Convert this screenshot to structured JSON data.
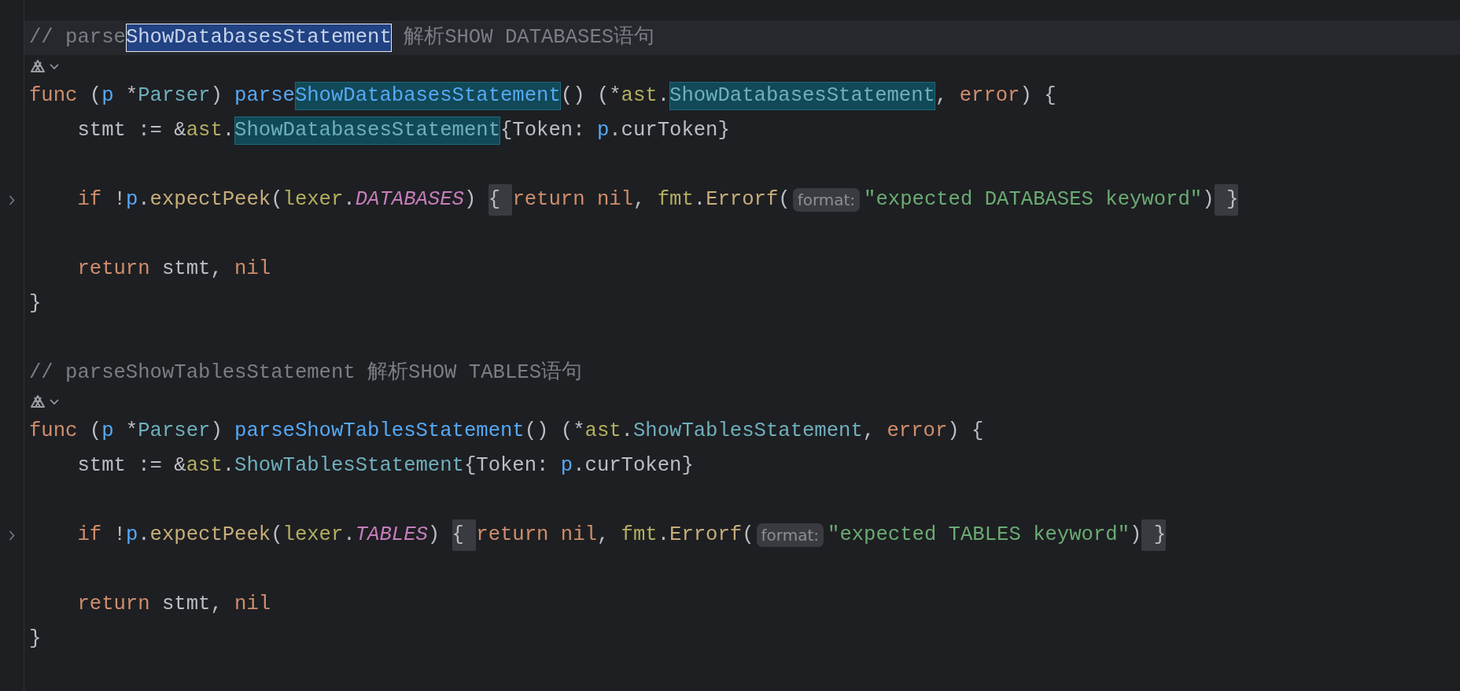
{
  "editor": {
    "lines": [
      {
        "kind": "code",
        "current": true,
        "folded": false,
        "tokens": [
          {
            "text": "// parse",
            "kind": "comment"
          },
          {
            "text": "ShowDatabasesStatement",
            "kind": "comment",
            "selected": true
          },
          {
            "text": " 解析SHOW DATABASES语句",
            "kind": "comment"
          }
        ]
      },
      {
        "kind": "gutter-icon"
      },
      {
        "kind": "code",
        "current": false,
        "folded": false,
        "tokens": [
          {
            "text": "func",
            "kind": "keyword"
          },
          {
            "text": " (",
            "kind": "plain"
          },
          {
            "text": "p",
            "kind": "receiver"
          },
          {
            "text": " *",
            "kind": "plain"
          },
          {
            "text": "Parser",
            "kind": "type"
          },
          {
            "text": ") ",
            "kind": "plain"
          },
          {
            "text": "parse",
            "kind": "decl"
          },
          {
            "text": "ShowDatabasesStatement",
            "kind": "decl",
            "highlighted": true
          },
          {
            "text": "() (*",
            "kind": "plain"
          },
          {
            "text": "ast",
            "kind": "package"
          },
          {
            "text": ".",
            "kind": "plain"
          },
          {
            "text": "ShowDatabasesStatement",
            "kind": "type",
            "highlighted": true
          },
          {
            "text": ", ",
            "kind": "plain"
          },
          {
            "text": "error",
            "kind": "keyword"
          },
          {
            "text": ") {",
            "kind": "plain"
          }
        ]
      },
      {
        "kind": "code",
        "current": false,
        "folded": false,
        "tokens": [
          {
            "text": "    stmt := &",
            "kind": "plain"
          },
          {
            "text": "ast",
            "kind": "package"
          },
          {
            "text": ".",
            "kind": "plain"
          },
          {
            "text": "ShowDatabasesStatement",
            "kind": "type",
            "highlighted": true
          },
          {
            "text": "{Token: ",
            "kind": "plain"
          },
          {
            "text": "p",
            "kind": "receiver"
          },
          {
            "text": ".curToken}",
            "kind": "plain"
          }
        ]
      },
      {
        "kind": "blank"
      },
      {
        "kind": "code",
        "current": false,
        "folded": true,
        "tokens": [
          {
            "text": "    if",
            "kind": "keyword"
          },
          {
            "text": " !",
            "kind": "plain"
          },
          {
            "text": "p",
            "kind": "receiver"
          },
          {
            "text": ".",
            "kind": "plain"
          },
          {
            "text": "expectPeek",
            "kind": "call"
          },
          {
            "text": "(",
            "kind": "plain"
          },
          {
            "text": "lexer",
            "kind": "package"
          },
          {
            "text": ".",
            "kind": "plain"
          },
          {
            "text": "DATABASES",
            "kind": "constant"
          },
          {
            "text": ") ",
            "kind": "plain"
          },
          {
            "text": "{",
            "kind": "fold-open"
          },
          {
            "text": "return nil",
            "kind": "keyword"
          },
          {
            "text": ", ",
            "kind": "plain"
          },
          {
            "text": "fmt",
            "kind": "package"
          },
          {
            "text": ".",
            "kind": "plain"
          },
          {
            "text": "Errorf",
            "kind": "call"
          },
          {
            "text": "(",
            "kind": "plain"
          },
          {
            "text": "format:",
            "kind": "hint"
          },
          {
            "text": "\"expected DATABASES keyword\"",
            "kind": "string"
          },
          {
            "text": ")",
            "kind": "plain"
          },
          {
            "text": "}",
            "kind": "fold-close"
          }
        ]
      },
      {
        "kind": "blank"
      },
      {
        "kind": "code",
        "current": false,
        "folded": false,
        "tokens": [
          {
            "text": "    return",
            "kind": "keyword"
          },
          {
            "text": " stmt, ",
            "kind": "plain"
          },
          {
            "text": "nil",
            "kind": "keyword"
          }
        ]
      },
      {
        "kind": "code",
        "current": false,
        "folded": false,
        "tokens": [
          {
            "text": "}",
            "kind": "plain"
          }
        ]
      },
      {
        "kind": "blank"
      },
      {
        "kind": "code",
        "current": false,
        "folded": false,
        "tokens": [
          {
            "text": "// parseShowTablesStatement 解析SHOW TABLES语句",
            "kind": "comment"
          }
        ]
      },
      {
        "kind": "gutter-icon"
      },
      {
        "kind": "code",
        "current": false,
        "folded": false,
        "tokens": [
          {
            "text": "func",
            "kind": "keyword"
          },
          {
            "text": " (",
            "kind": "plain"
          },
          {
            "text": "p",
            "kind": "receiver"
          },
          {
            "text": " *",
            "kind": "plain"
          },
          {
            "text": "Parser",
            "kind": "type"
          },
          {
            "text": ") ",
            "kind": "plain"
          },
          {
            "text": "parseShowTablesStatement",
            "kind": "decl"
          },
          {
            "text": "() (*",
            "kind": "plain"
          },
          {
            "text": "ast",
            "kind": "package"
          },
          {
            "text": ".",
            "kind": "plain"
          },
          {
            "text": "ShowTablesStatement",
            "kind": "type"
          },
          {
            "text": ", ",
            "kind": "plain"
          },
          {
            "text": "error",
            "kind": "keyword"
          },
          {
            "text": ") {",
            "kind": "plain"
          }
        ]
      },
      {
        "kind": "code",
        "current": false,
        "folded": false,
        "tokens": [
          {
            "text": "    stmt := &",
            "kind": "plain"
          },
          {
            "text": "ast",
            "kind": "package"
          },
          {
            "text": ".",
            "kind": "plain"
          },
          {
            "text": "ShowTablesStatement",
            "kind": "type"
          },
          {
            "text": "{Token: ",
            "kind": "plain"
          },
          {
            "text": "p",
            "kind": "receiver"
          },
          {
            "text": ".curToken}",
            "kind": "plain"
          }
        ]
      },
      {
        "kind": "blank"
      },
      {
        "kind": "code",
        "current": false,
        "folded": true,
        "tokens": [
          {
            "text": "    if",
            "kind": "keyword"
          },
          {
            "text": " !",
            "kind": "plain"
          },
          {
            "text": "p",
            "kind": "receiver"
          },
          {
            "text": ".",
            "kind": "plain"
          },
          {
            "text": "expectPeek",
            "kind": "call"
          },
          {
            "text": "(",
            "kind": "plain"
          },
          {
            "text": "lexer",
            "kind": "package"
          },
          {
            "text": ".",
            "kind": "plain"
          },
          {
            "text": "TABLES",
            "kind": "constant"
          },
          {
            "text": ") ",
            "kind": "plain"
          },
          {
            "text": "{",
            "kind": "fold-open"
          },
          {
            "text": "return nil",
            "kind": "keyword"
          },
          {
            "text": ", ",
            "kind": "plain"
          },
          {
            "text": "fmt",
            "kind": "package"
          },
          {
            "text": ".",
            "kind": "plain"
          },
          {
            "text": "Errorf",
            "kind": "call"
          },
          {
            "text": "(",
            "kind": "plain"
          },
          {
            "text": "format:",
            "kind": "hint"
          },
          {
            "text": "\"expected TABLES keyword\"",
            "kind": "string"
          },
          {
            "text": ")",
            "kind": "plain"
          },
          {
            "text": "}",
            "kind": "fold-close"
          }
        ]
      },
      {
        "kind": "blank"
      },
      {
        "kind": "code",
        "current": false,
        "folded": false,
        "tokens": [
          {
            "text": "    return",
            "kind": "keyword"
          },
          {
            "text": " stmt, ",
            "kind": "plain"
          },
          {
            "text": "nil",
            "kind": "keyword"
          }
        ]
      },
      {
        "kind": "code",
        "current": false,
        "folded": false,
        "tokens": [
          {
            "text": "}",
            "kind": "plain"
          }
        ]
      }
    ]
  }
}
